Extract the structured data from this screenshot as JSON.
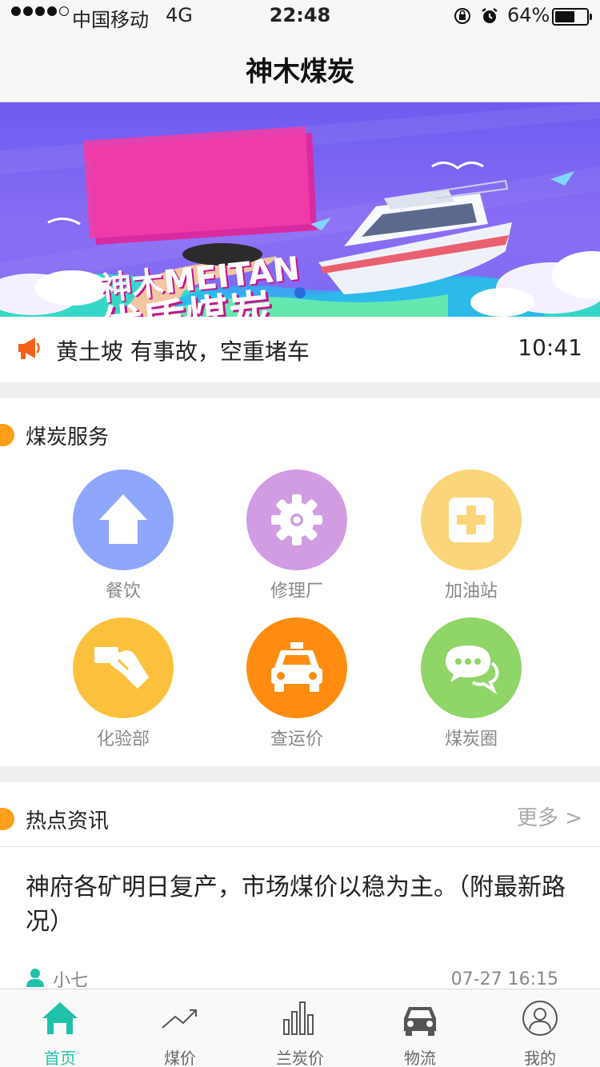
{
  "status_bar": {
    "carrier": "中国移动",
    "network": "4G",
    "time": "22:48",
    "battery_percent": "64%",
    "battery_level": 0.64,
    "signal_bars": 4
  },
  "nav": {
    "title": "神木煤炭"
  },
  "banner": {
    "line1": "神木MEITAN",
    "line2": "优质煤炭",
    "slide_count": 1,
    "active_slide": 1
  },
  "notice": {
    "text": "黄土坡 有事故，空重堵车",
    "time": "10:41",
    "icon": "megaphone-icon"
  },
  "services": {
    "title": "煤炭服务",
    "items": [
      {
        "label": "餐饮",
        "icon": "house-icon",
        "color": "#8ea6fb"
      },
      {
        "label": "修理厂",
        "icon": "gear-icon",
        "color": "#d19ce1"
      },
      {
        "label": "加油站",
        "icon": "plus-box-icon",
        "color": "#fbd57a"
      },
      {
        "label": "化验部",
        "icon": "hand-card-icon",
        "color": "#fcc13c"
      },
      {
        "label": "查运价",
        "icon": "taxi-icon",
        "color": "#fd8c11"
      },
      {
        "label": "煤炭圈",
        "icon": "chat-bubbles-icon",
        "color": "#8fd567"
      }
    ]
  },
  "news": {
    "title": "热点资讯",
    "more": "更多 >",
    "items": [
      {
        "headline": "神府各矿明日复产，市场煤价以稳为主。（附最新路况）",
        "author": "小七",
        "date": "07-27 16:15"
      }
    ]
  },
  "tabs": [
    {
      "label": "首页",
      "icon": "home-icon",
      "active": true
    },
    {
      "label": "煤价",
      "icon": "trend-up-icon",
      "active": false
    },
    {
      "label": "兰炭价",
      "icon": "bar-chart-icon",
      "active": false
    },
    {
      "label": "物流",
      "icon": "car-icon",
      "active": false
    },
    {
      "label": "我的",
      "icon": "user-circle-icon",
      "active": false
    }
  ],
  "colors": {
    "accent": "#1fc2a8",
    "section_marker": "#ff9f1a",
    "notice_icon": "#f2621a"
  }
}
